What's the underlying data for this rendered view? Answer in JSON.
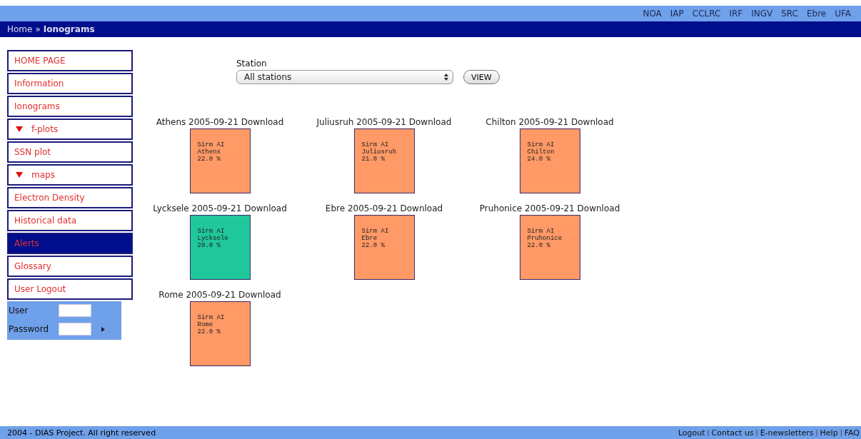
{
  "top_links": [
    "NOA",
    "IAP",
    "CCLRC",
    "IRF",
    "INGV",
    "SRC",
    "Ebre",
    "UFA"
  ],
  "breadcrumb": {
    "home": "Home",
    "separator": "»",
    "current": "Ionograms"
  },
  "sidebar": {
    "items": [
      {
        "label": "HOME PAGE",
        "kind": "link",
        "selected": false
      },
      {
        "label": "Information",
        "kind": "link",
        "selected": false
      },
      {
        "label": "Ionograms",
        "kind": "link",
        "selected": false
      },
      {
        "label": "f-plots",
        "kind": "expandable",
        "selected": false
      },
      {
        "label": "SSN plot",
        "kind": "link",
        "selected": false
      },
      {
        "label": "maps",
        "kind": "expandable",
        "selected": false
      },
      {
        "label": "Electron Density",
        "kind": "link",
        "selected": false
      },
      {
        "label": "Historical data",
        "kind": "link",
        "selected": false
      },
      {
        "label": "Alerts",
        "kind": "link",
        "selected": true
      },
      {
        "label": "Glossary",
        "kind": "link",
        "selected": false
      },
      {
        "label": "User Logout",
        "kind": "link",
        "selected": false
      }
    ],
    "login": {
      "user_label": "User",
      "password_label": "Password"
    }
  },
  "filter": {
    "label": "Station",
    "value": "All stations",
    "button": "VIEW"
  },
  "cards": [
    {
      "station": "Athens",
      "date": "2005-09-21",
      "link": "Download",
      "lines": [
        "Sirm AI",
        "Athens",
        "22.0 %"
      ],
      "color": "#ff9966"
    },
    {
      "station": "Juliusruh",
      "date": "2005-09-21",
      "link": "Download",
      "lines": [
        "Sirm AI",
        "Juliusruh",
        "21.0 %"
      ],
      "color": "#ff9966"
    },
    {
      "station": "Chilton",
      "date": "2005-09-21",
      "link": "Download",
      "lines": [
        "Sirm AI",
        "Chilton",
        "24.0 %"
      ],
      "color": "#ff9966"
    },
    {
      "station": "Lycksele",
      "date": "2005-09-21",
      "link": "Download",
      "lines": [
        "Sirm AI",
        "Lycksele",
        "20.0 %"
      ],
      "color": "#1fc79a"
    },
    {
      "station": "Ebre",
      "date": "2005-09-21",
      "link": "Download",
      "lines": [
        "Sirm AI",
        "Ebre",
        "22.0 %"
      ],
      "color": "#ff9966"
    },
    {
      "station": "Pruhonice",
      "date": "2005-09-21",
      "link": "Download",
      "lines": [
        "Sirm AI",
        "Pruhonice",
        "22.0 %"
      ],
      "color": "#ff9966"
    },
    {
      "station": "Rome",
      "date": "2005-09-21",
      "link": "Download",
      "lines": [
        "Sirm AI",
        "Rome",
        "22.0 %"
      ],
      "color": "#ff9966"
    }
  ],
  "footer": {
    "copyright": "2004 - DIAS Project. All right reserved",
    "links": [
      "Logout",
      "Contact us",
      "E-newsletters",
      "Help",
      "FAQ"
    ],
    "separators": [
      "|",
      "|",
      "|",
      "|"
    ]
  }
}
